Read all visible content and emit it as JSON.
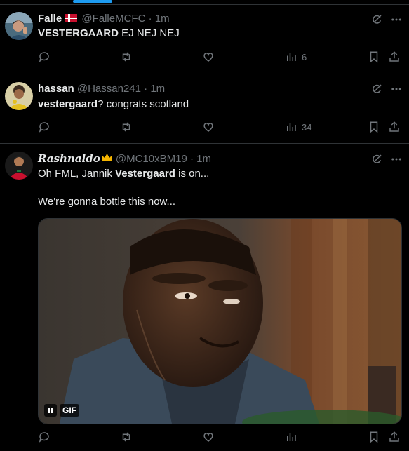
{
  "tweets": [
    {
      "name": "Falle",
      "handle": "@FalleMCFC",
      "sep": "·",
      "time": "1m",
      "body_bold": "VESTERGAARD",
      "body_rest": " EJ NEJ NEJ",
      "views": "6"
    },
    {
      "name": "hassan",
      "handle": "@Hassan241",
      "sep": "·",
      "time": "1m",
      "body_bold": "vestergaard",
      "body_rest": "? congrats scotland",
      "views": "34"
    },
    {
      "name": "Rashnaldo",
      "handle": "@MC10xBM19",
      "sep": "·",
      "time": "1m",
      "line1_pre": "Oh FML, Jannik ",
      "line1_bold": "Vestergaard",
      "line1_post": " is on...",
      "line2": "We're gonna bottle this now...",
      "gif_label": "GIF",
      "views": ""
    }
  ],
  "icons": {
    "reply": "reply-icon",
    "repost": "repost-icon",
    "like": "like-icon",
    "views": "views-icon",
    "bookmark": "bookmark-icon",
    "share": "share-icon",
    "grok": "grok-icon",
    "more": "more-icon"
  },
  "colors": {
    "background": "#000000",
    "text": "#e7e9ea",
    "secondary": "#71767b",
    "accent": "#1d9bf0",
    "divider": "#2f3336"
  }
}
